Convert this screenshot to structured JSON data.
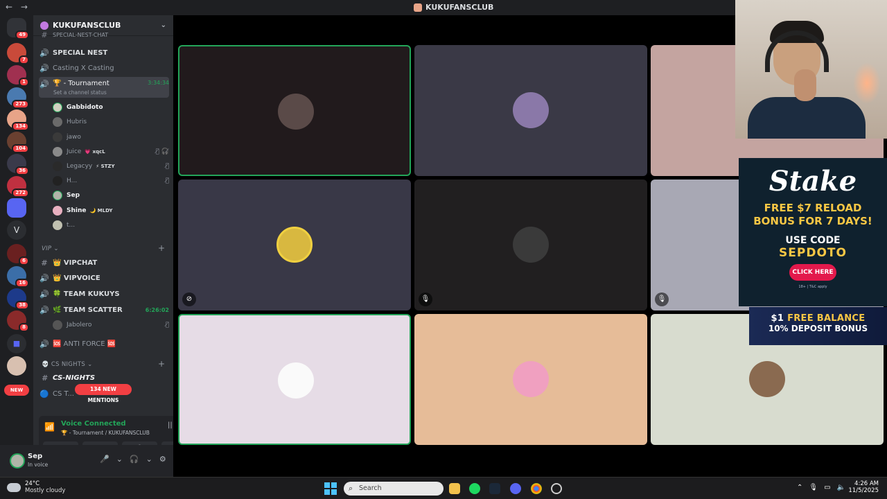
{
  "window": {
    "title": "KUKUFANSCLUB",
    "back": "←",
    "forward": "→"
  },
  "servers": {
    "badges": [
      "49",
      "7",
      "1",
      "273",
      "134",
      "104",
      "36",
      "272",
      "6",
      "16",
      "38",
      "8"
    ],
    "folder_letter": "V",
    "new_label": "NEW"
  },
  "guild": {
    "name": "KUKUFANSCLUB"
  },
  "channels": {
    "cut_top": "SPECIAL-NEST-CHAT",
    "special_nest": "SPECIAL NEST",
    "casting": "Casting X Casting",
    "tournament": {
      "name": "🏆 - Tournament",
      "time": "3:34:34",
      "status": "Set a channel status"
    },
    "members": [
      {
        "name": "Gabbidoto",
        "tag": ""
      },
      {
        "name": "Hubris",
        "tag": ""
      },
      {
        "name": "jawo",
        "tag": ""
      },
      {
        "name": "Juice",
        "tag": "💗 xqcL"
      },
      {
        "name": "Legacyy",
        "tag": "⚡ STZY"
      },
      {
        "name": "H...",
        "tag": ""
      },
      {
        "name": "Sep",
        "tag": ""
      },
      {
        "name": "Shine",
        "tag": "🌙 MLDY"
      },
      {
        "name": "t...",
        "tag": ""
      }
    ],
    "vip_category": "VIP",
    "vipchat": "👑 VIPCHAT",
    "vipvoice": "👑 VIPVOICE",
    "team_kukuys": "🍀 TEAM KUKUYS",
    "team_scatter": "🌿 TEAM SCATTER",
    "team_scatter_time": "6:26:02",
    "jabolero": "Jabolero",
    "anti_force": "🆘 ANTI FORCE 🆘",
    "cs_category": "CS NIGHTS",
    "cs_nights": "CS-NIGHTS",
    "cs_t": "CS T...",
    "mentions": "134 NEW MENTIONS"
  },
  "voice": {
    "status": "Voice Connected",
    "location": "🏆 - Tournament / KUKUFANSCLUB"
  },
  "user": {
    "name": "Sep",
    "status": "In voice"
  },
  "ad": {
    "brand": "Stake",
    "line1": "FREE $7 RELOAD",
    "line2": "BONUS FOR 7 DAYS!",
    "code_label": "USE CODE",
    "code": "SEPDOTO",
    "cta": "CLICK HERE",
    "fine": "18+ | T&C apply",
    "banner_a1": "$1",
    "banner_a2": "FREE BALANCE",
    "banner_b": "10% DEPOSIT BONUS"
  },
  "taskbar": {
    "temp": "24°C",
    "weather": "Mostly cloudy",
    "search": "Search",
    "time": "4:26 AM",
    "date": "11/5/2025"
  },
  "colors": {
    "accent_green": "#23a559",
    "brand_red": "#f23f43",
    "stake_yellow": "#f9c744"
  }
}
